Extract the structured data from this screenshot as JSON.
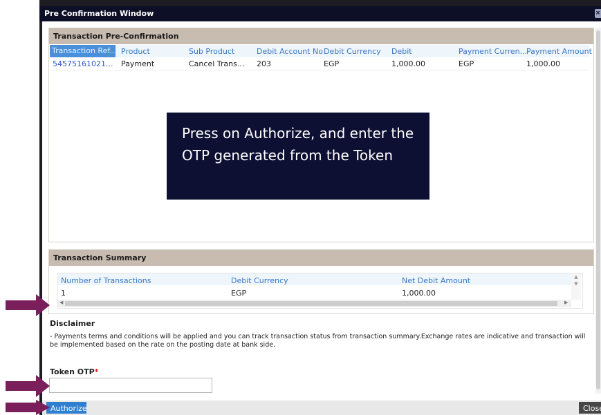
{
  "window": {
    "title": "Pre Confirmation Window"
  },
  "preconfirm": {
    "title": "Transaction Pre-Confirmation",
    "columns": [
      "Transaction Ref...",
      "Product",
      "Sub Product",
      "Debit Account No",
      "Debit Currency",
      "Debit",
      "Payment Curren...",
      "Payment Amount"
    ],
    "row": [
      "54575161021...",
      "Payment",
      "Cancel Trans...",
      "203",
      "EGP",
      "1,000.00",
      "EGP",
      "1,000.00"
    ]
  },
  "tooltip": {
    "text": "Press on Authorize, and enter the OTP generated from the Token"
  },
  "summary": {
    "title": "Transaction Summary",
    "columns": [
      "Number of Transactions",
      "Debit Currency",
      "Net Debit Amount"
    ],
    "row": [
      "1",
      "EGP",
      "1,000.00"
    ]
  },
  "disclaimer": {
    "title": "Disclaimer",
    "text": "- Payments terms and conditions will be applied and you can track transaction status from transaction summary.Exchange rates are indicative and transaction will be implemented based on the rate on the posting date at bank side."
  },
  "token": {
    "label": "Token OTP",
    "required_mark": "*",
    "value": ""
  },
  "buttons": {
    "authorize": "Authorize",
    "close": "Close"
  },
  "colors": {
    "arrow": "#7a1f5c",
    "tooltip_bg": "#0d0f33",
    "header": "#c8bbb0",
    "accent": "#2e7fd0"
  }
}
